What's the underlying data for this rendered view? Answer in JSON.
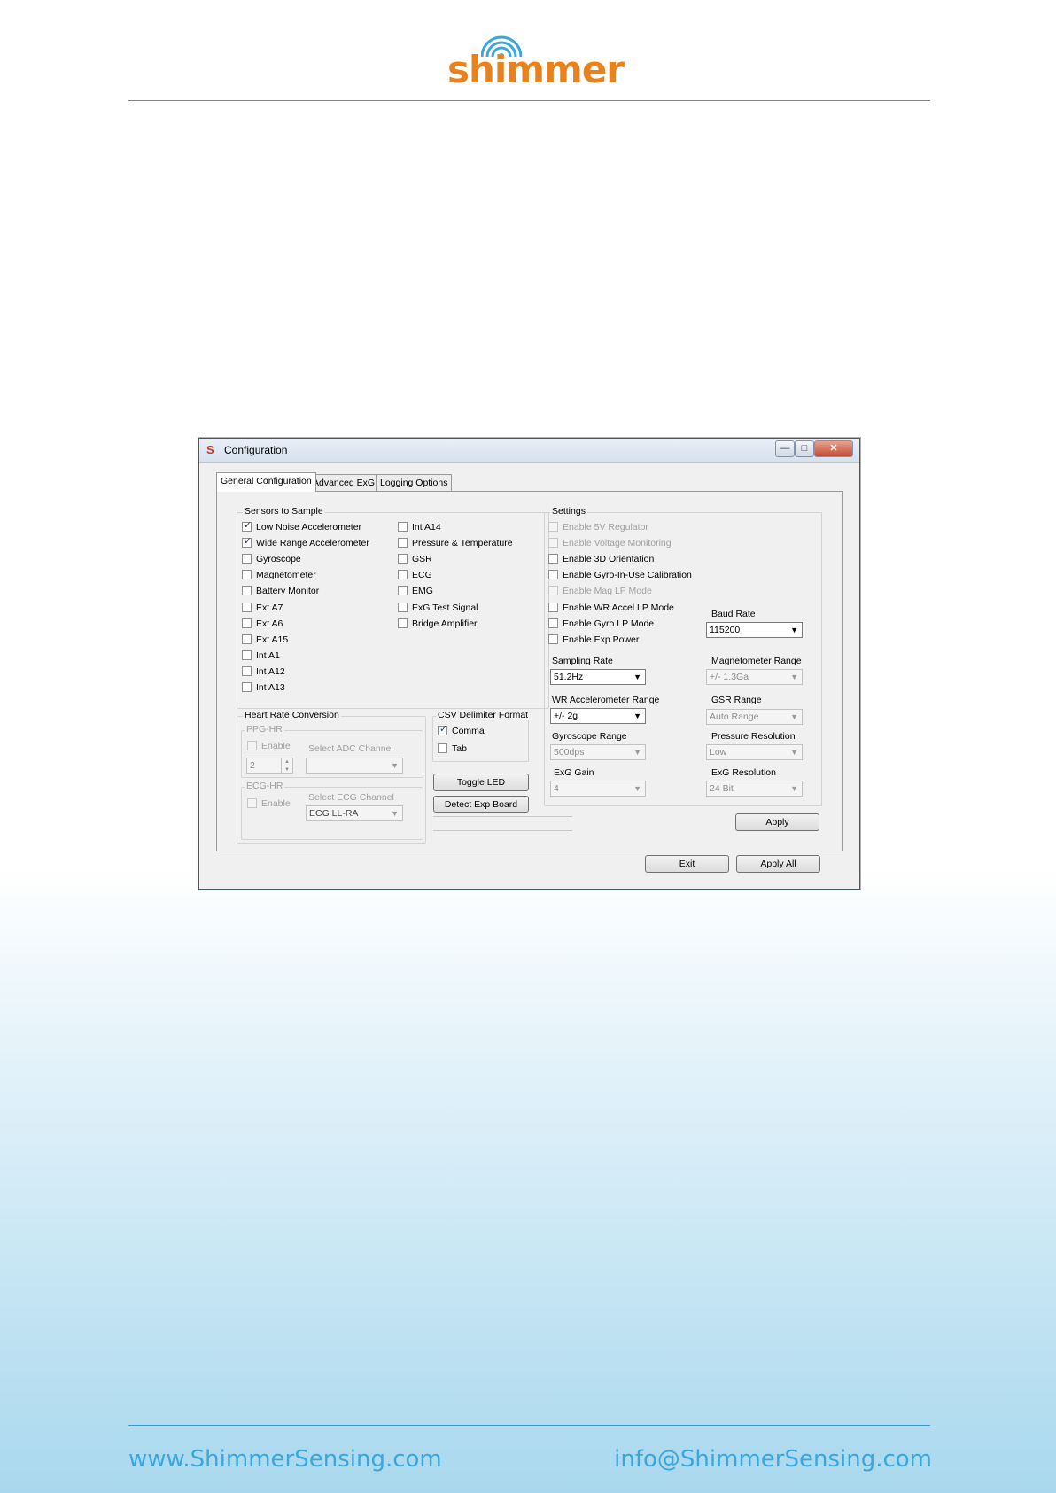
{
  "brand": {
    "logo_text": "shimmer",
    "website": "www.ShimmerSensing.com",
    "email": "info@ShimmerSensing.com",
    "accent_color": "#e8821e",
    "rule_color": "#3a9ad9"
  },
  "window": {
    "title": "Configuration",
    "controls": {
      "minimize": "—",
      "maximize": "□",
      "close": "✕"
    }
  },
  "tabs": [
    {
      "label": "General Configuration",
      "active": true
    },
    {
      "label": "Advanced ExG",
      "active": false
    },
    {
      "label": "Logging Options",
      "active": false
    }
  ],
  "sensors": {
    "title": "Sensors to Sample",
    "col1": [
      {
        "label": "Low Noise Accelerometer",
        "checked": true
      },
      {
        "label": "Wide Range Accelerometer",
        "checked": true
      },
      {
        "label": "Gyroscope",
        "checked": false
      },
      {
        "label": "Magnetometer",
        "checked": false
      },
      {
        "label": "Battery Monitor",
        "checked": false
      },
      {
        "label": "Ext A7",
        "checked": false
      },
      {
        "label": "Ext A6",
        "checked": false
      },
      {
        "label": "Ext A15",
        "checked": false
      },
      {
        "label": "Int A1",
        "checked": false
      },
      {
        "label": "Int A12",
        "checked": false
      },
      {
        "label": "Int A13",
        "checked": false
      }
    ],
    "col2": [
      {
        "label": "Int A14",
        "checked": false
      },
      {
        "label": "Pressure & Temperature",
        "checked": false
      },
      {
        "label": "GSR",
        "checked": false
      },
      {
        "label": "ECG",
        "checked": false
      },
      {
        "label": "EMG",
        "checked": false
      },
      {
        "label": "ExG Test Signal",
        "checked": false
      },
      {
        "label": "Bridge Amplifier",
        "checked": false
      }
    ]
  },
  "settings": {
    "title": "Settings",
    "options": [
      {
        "label": "Enable 5V Regulator",
        "checked": false,
        "disabled": true
      },
      {
        "label": "Enable Voltage Monitoring",
        "checked": false,
        "disabled": true
      },
      {
        "label": "Enable 3D Orientation",
        "checked": false,
        "disabled": false
      },
      {
        "label": "Enable Gyro-In-Use Calibration",
        "checked": false,
        "disabled": false
      },
      {
        "label": "Enable Mag LP Mode",
        "checked": false,
        "disabled": true
      },
      {
        "label": "Enable WR Accel LP Mode",
        "checked": false,
        "disabled": false
      },
      {
        "label": "Enable Gyro LP Mode",
        "checked": false,
        "disabled": false
      },
      {
        "label": "Enable Exp Power",
        "checked": false,
        "disabled": false
      }
    ],
    "baud_rate": {
      "label": "Baud Rate",
      "value": "115200"
    },
    "sampling_rate": {
      "label": "Sampling Rate",
      "value": "51.2Hz"
    },
    "magnetometer_range": {
      "label": "Magnetometer Range",
      "value": "+/- 1.3Ga"
    },
    "wr_accel_range": {
      "label": "WR Accelerometer Range",
      "value": "+/- 2g"
    },
    "gsr_range": {
      "label": "GSR Range",
      "value": "Auto Range"
    },
    "gyro_range": {
      "label": "Gyroscope Range",
      "value": "500dps"
    },
    "pressure_resolution": {
      "label": "Pressure Resolution",
      "value": "Low"
    },
    "exg_gain": {
      "label": "ExG Gain",
      "value": "4"
    },
    "exg_resolution": {
      "label": "ExG Resolution",
      "value": "24 Bit"
    },
    "apply_label": "Apply"
  },
  "heart_rate": {
    "title": "Heart Rate Conversion",
    "ppg": {
      "title": "PPG-HR",
      "enable_label": "Enable",
      "channel_label": "Select ADC Channel",
      "spin_value": "2",
      "channel_value": ""
    },
    "ecg": {
      "title": "ECG-HR",
      "enable_label": "Enable",
      "channel_label": "Select ECG Channel",
      "channel_value": "ECG LL-RA"
    }
  },
  "csv": {
    "title": "CSV Delimiter Format",
    "options": [
      {
        "label": "Comma",
        "checked": true
      },
      {
        "label": "Tab",
        "checked": false
      }
    ]
  },
  "buttons": {
    "toggle_led": "Toggle LED",
    "detect_exp_board": "Detect Exp Board",
    "exit": "Exit",
    "apply_all": "Apply All"
  }
}
